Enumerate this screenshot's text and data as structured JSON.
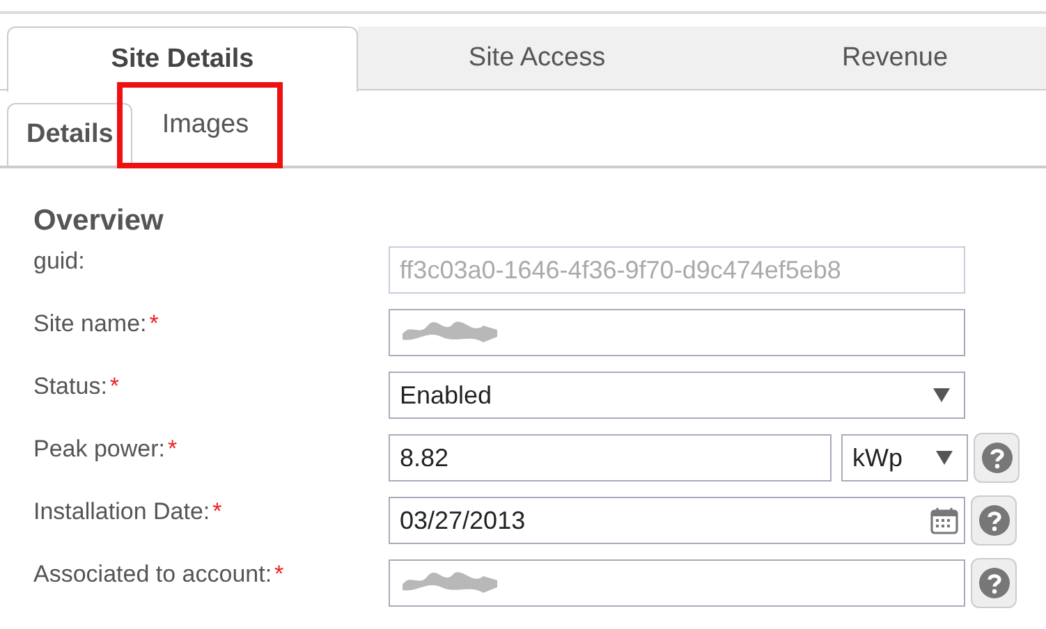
{
  "tabs": [
    {
      "label": "Site Details",
      "selected": true
    },
    {
      "label": "Site Access",
      "selected": false
    },
    {
      "label": "Revenue",
      "selected": false
    }
  ],
  "subtabs": [
    {
      "label": "Details",
      "selected": true,
      "highlighted": false
    },
    {
      "label": "Images",
      "selected": false,
      "highlighted": true
    }
  ],
  "section": {
    "title": "Overview",
    "fields": [
      {
        "label": "guid:",
        "kind": "text",
        "value": "ff3c03a0-1646-4f36-9f70-d9c474ef5eb8",
        "disabled": true,
        "redacted": false,
        "help": false
      },
      {
        "label": "Site name:",
        "required_mark": "*",
        "kind": "text",
        "disabled": false,
        "redacted": true,
        "help": false
      },
      {
        "label": "Status:",
        "required_mark": "*",
        "kind": "select",
        "value": "Enabled",
        "disabled": false,
        "redacted": false,
        "help": false
      },
      {
        "label": "Peak power:",
        "required_mark": "*",
        "kind": "unit",
        "value": "8.82",
        "unit": "kWp",
        "disabled": false,
        "redacted": false,
        "help": true
      },
      {
        "label": "Installation Date:",
        "required_mark": "*",
        "kind": "date",
        "value": "03/27/2013",
        "disabled": false,
        "redacted": false,
        "help": true
      },
      {
        "label": "Associated to account:",
        "required_mark": "*",
        "kind": "text",
        "disabled": false,
        "redacted": true,
        "help": true
      }
    ]
  }
}
